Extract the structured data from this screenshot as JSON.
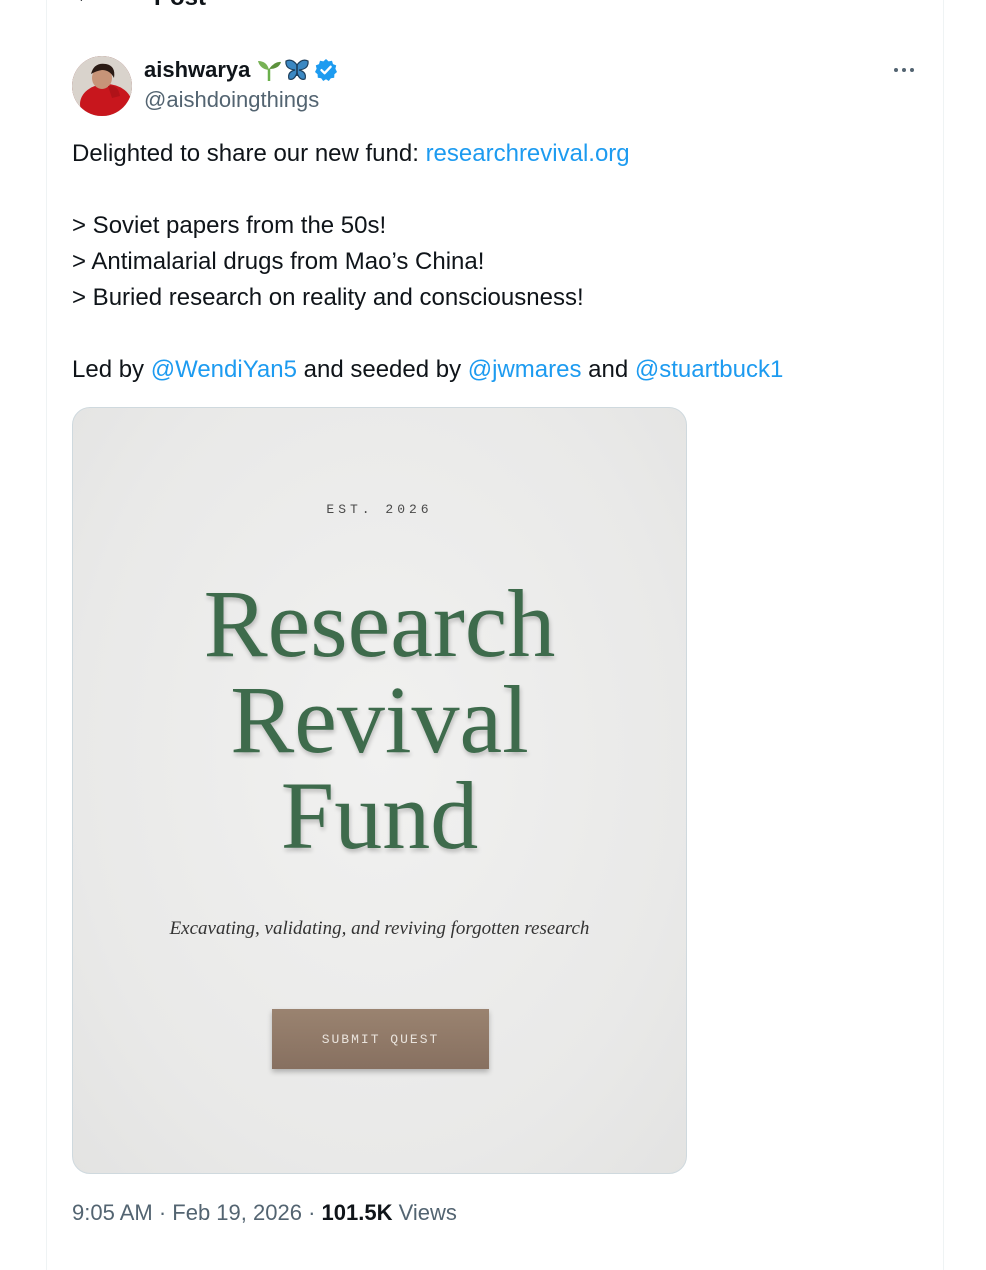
{
  "header": {
    "back_icon": "arrow-left-icon",
    "title": "Post"
  },
  "post": {
    "author_name": "aishwarya",
    "author_emoji": [
      "seedling-icon",
      "butterfly-icon"
    ],
    "verified_icon": "verified-badge-icon",
    "handle": "@aishdoingthings",
    "more_icon": "more-horizontal-icon",
    "text": {
      "intro": "Delighted to share our new fund: ",
      "intro_link": "researchrevival.org",
      "bullet_1": "> Soviet papers from the 50s!",
      "bullet_2": "> Antimalarial drugs from Mao’s China!",
      "bullet_3": "> Buried research on reality and consciousness!",
      "led_prefix": "Led by ",
      "mention_1": "@WendiYan5",
      "seeded_text": " and seeded by ",
      "mention_2": "@jwmares",
      "and_text": " and ",
      "mention_3": "@stuartbuck1"
    },
    "media": {
      "est": "EST. 2026",
      "title_line_1": "Research",
      "title_line_2": "Revival",
      "title_line_3": "Fund",
      "tagline": "Excavating, validating, and reviving forgotten research",
      "button": "SUBMIT QUEST"
    },
    "time": "9:05 AM",
    "sep_1": " · ",
    "date": "Feb 19, 2026",
    "sep_2": " · ",
    "views_count": "101.5K",
    "views_label": " Views"
  },
  "colors": {
    "link": "#1d9bf0",
    "title_green": "#3e6b4c",
    "button_brown": "#8e7866",
    "muted": "#536471"
  }
}
